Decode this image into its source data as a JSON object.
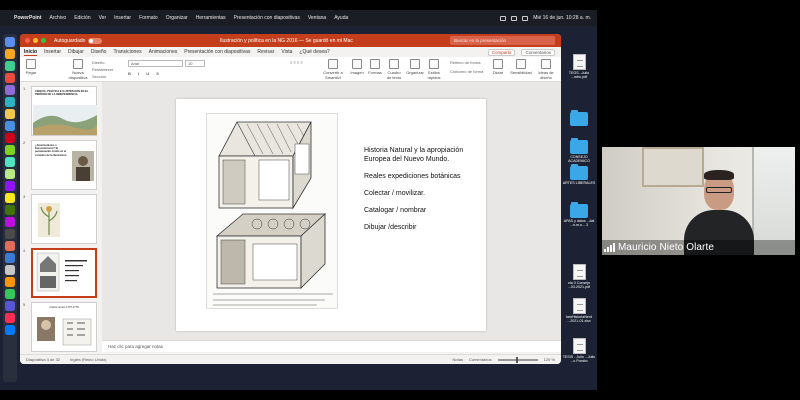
{
  "menubar": {
    "app": "PowerPoint",
    "items": [
      "Archivo",
      "Edición",
      "Ver",
      "Insertar",
      "Formato",
      "Organizar",
      "Herramientas",
      "Presentación con diapositivas",
      "Ventana",
      "Ayuda"
    ],
    "clock": "Mié 16 de jun. 10:28 a. m."
  },
  "window": {
    "autosave_label": "Autoguardado",
    "title": "Ilustración y política en la NG 2016 — Se guardó en mi Mac",
    "search_placeholder": "Buscar en la presentación"
  },
  "ribbon": {
    "tabs": [
      "Inicio",
      "Insertar",
      "Dibujar",
      "Diseño",
      "Transiciones",
      "Animaciones",
      "Presentación con diapositivas",
      "Revisar",
      "Vista",
      "¿Qué desea?"
    ],
    "active_tab": "Inicio",
    "share_label": "Compartir",
    "comments_label": "Comentarios",
    "paste_label": "Pegar",
    "new_slide_label": "Nueva diapositiva",
    "design_label": "Diseño",
    "reset_label": "Restablecer",
    "section_label": "Sección",
    "font_name": "Arial",
    "font_size": "10",
    "convert_smartart_label": "Convertir a SmartArt",
    "image_label": "Imagen",
    "shapes_label": "Formas",
    "textbox_label": "Cuadro de texto",
    "arrange_label": "Organizar",
    "quick_styles_label": "Estilos rápidos",
    "fill_label": "Relleno de forma",
    "outline_label": "Contorno de forma",
    "dictate_label": "Dictar",
    "sensitivity_label": "Sensibilidad",
    "design_ideas_label": "Ideas de diseño"
  },
  "thumbnails": [
    {
      "num": "1",
      "title": "CIENCIA, POLÍTICA E ILUSTRACIÓN EN EL PERÍODO DE LA INDEPENDENCIA"
    },
    {
      "num": "2",
      "title": "¿Americanismo o Eurocentrismo? El pensamiento criollo en el contexto de la Ilustración"
    },
    {
      "num": "3",
      "title": ""
    },
    {
      "num": "4",
      "title": ""
    },
    {
      "num": "5",
      "title": "Carlos Linneo 1707-1778"
    }
  ],
  "slide": {
    "lines": [
      "Historia Natural y la apropiación Europea del Nuevo Mundo.",
      "Reales expediciones botánicas",
      "Colectar / movilizar.",
      "Catalogar / nombrar",
      "Dibujar /describir"
    ]
  },
  "notes_placeholder": "Haz clic para agregar notas",
  "status": {
    "slide_counter": "Diapositiva 4 de 32",
    "language": "Inglés (Reino Unido)",
    "notes_label": "Notas",
    "comments_label": "Comentarios",
    "zoom": "129 %"
  },
  "desktop": [
    {
      "type": "file",
      "label": "TEGS...Julio ...mbo.pdf"
    },
    {
      "type": "folder",
      "label": ""
    },
    {
      "type": "folder",
      "label": "CONSEJO ACADEMICO"
    },
    {
      "type": "folder",
      "label": "ARTES LIBERALES"
    },
    {
      "type": "folder",
      "label": "APAS y datos ...ital ...n.m.u... 3"
    },
    {
      "type": "file",
      "label": "cta 0 Consejo ...03.2021.pdf"
    },
    {
      "type": "file",
      "label": "tamHistoriaNerd ...2021-01.xlsx"
    },
    {
      "type": "file",
      "label": "TESIS - Julio ...Julio ...o Pombo"
    }
  ],
  "video": {
    "participant": "Mauricio Nieto Olarte"
  },
  "colors": {
    "brand": "#c43e1c",
    "folder": "#3aa7e8"
  }
}
